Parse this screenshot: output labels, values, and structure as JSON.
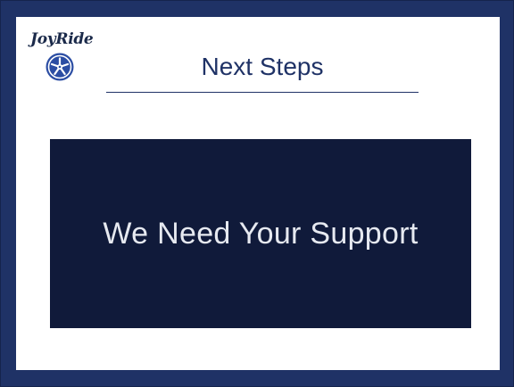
{
  "logo": {
    "text": "JoyRide",
    "icon": "wheel-icon"
  },
  "slide": {
    "title": "Next Steps",
    "banner_text": "We Need Your Support"
  },
  "colors": {
    "frame": "#1f3266",
    "banner": "#101a3a",
    "title": "#1f3266",
    "banner_text": "#e6e9f0"
  }
}
